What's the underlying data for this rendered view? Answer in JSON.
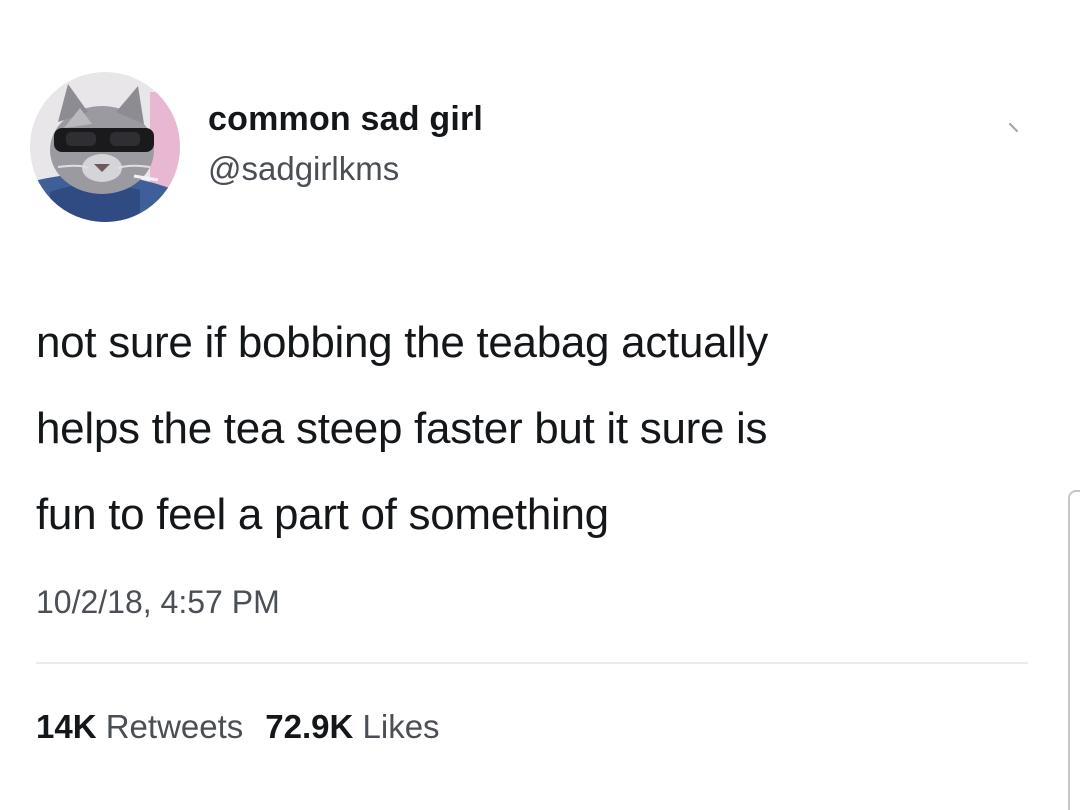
{
  "author": {
    "display_name": "common sad girl",
    "handle": "@sadgirlkms",
    "avatar_icon": "avatar-cat-sunglasses"
  },
  "menu_icon": "chevron-down-icon",
  "tweet": {
    "lines": [
      "not sure if bobbing the teabag actually",
      "helps the tea steep faster but it sure is",
      "fun to feel a part of something"
    ],
    "timestamp": "10/2/18, 4:57 PM"
  },
  "stats": {
    "retweets_count": "14K",
    "retweets_label": "Retweets",
    "likes_count": "72.9K",
    "likes_label": "Likes"
  },
  "colors": {
    "text": "#14171a",
    "secondary": "#4a4f55",
    "divider": "#e6ecf0"
  }
}
